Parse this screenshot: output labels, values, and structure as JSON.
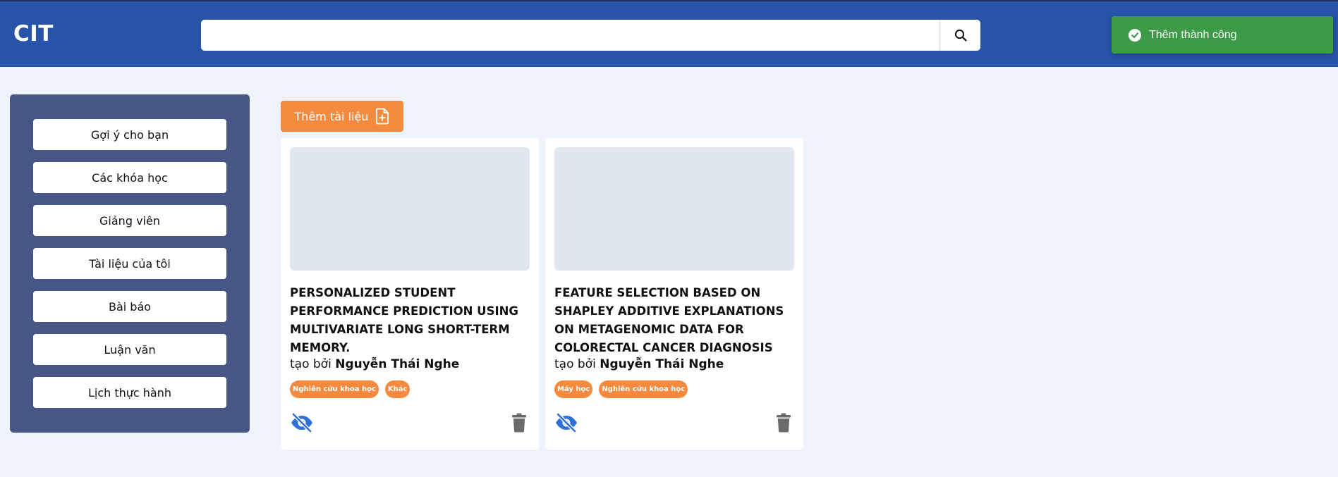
{
  "header": {
    "logo": "CIT",
    "search": {
      "value": "",
      "placeholder": ""
    }
  },
  "toast": {
    "message": "Thêm thành công",
    "color": "#3d9b48"
  },
  "sidebar": {
    "items": [
      {
        "label": "Gợi ý cho bạn"
      },
      {
        "label": "Các khóa học"
      },
      {
        "label": "Giảng viên"
      },
      {
        "label": "Tài liệu của tôi"
      },
      {
        "label": "Bài báo"
      },
      {
        "label": "Luận văn"
      },
      {
        "label": "Lịch thực hành"
      }
    ]
  },
  "main": {
    "add_button_label": "Thêm tài liệu",
    "accent_color": "#f58a3f",
    "cards": [
      {
        "title": "PERSONALIZED STUDENT PERFORMANCE PREDICTION USING MULTIVARIATE LONG SHORT-TERM MEMORY.",
        "author_prefix": "tạo bởi",
        "author": "Nguyễn Thái Nghe",
        "tags": [
          "Nghiên cứu khoa học",
          "Khác"
        ]
      },
      {
        "title": "FEATURE SELECTION BASED ON SHAPLEY ADDITIVE EXPLANATIONS ON METAGENOMIC DATA FOR COLORECTAL CANCER DIAGNOSIS",
        "author_prefix": "tạo bởi",
        "author": "Nguyễn Thái Nghe",
        "tags": [
          "Máy học",
          "Nghiên cứu khoa học"
        ]
      }
    ]
  },
  "icons": {
    "search": "search-icon",
    "toast": "check-circle-icon",
    "add": "file-plus-icon",
    "visibility": "eye-slash-icon",
    "delete": "trash-icon"
  }
}
